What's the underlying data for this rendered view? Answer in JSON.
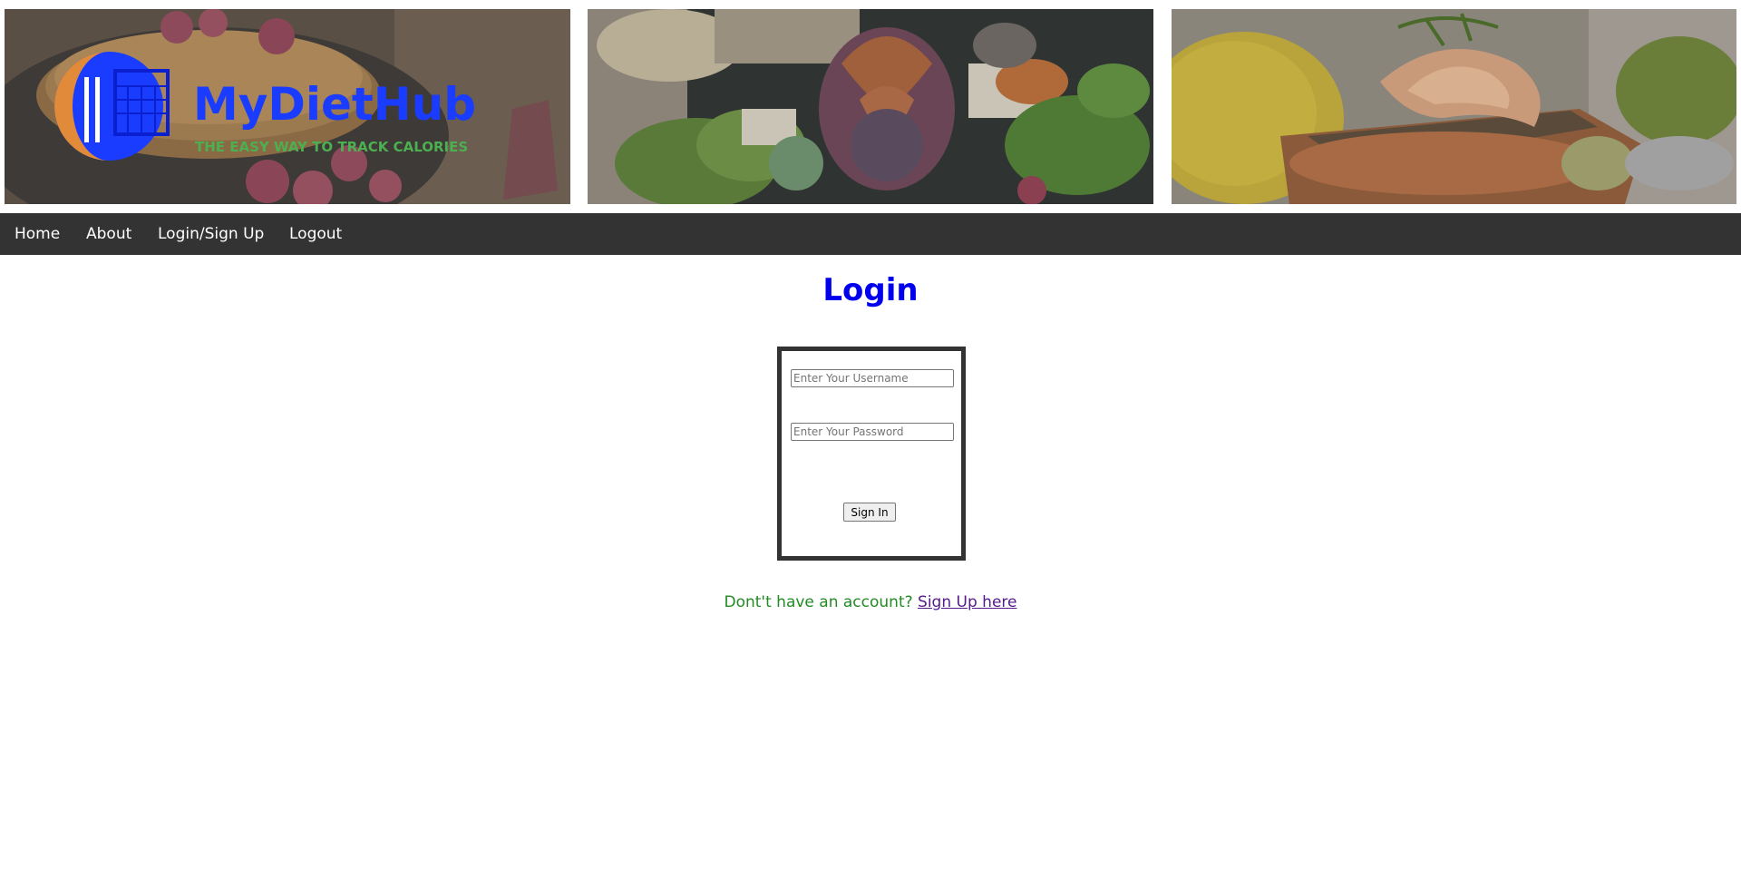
{
  "banner": {
    "logo": {
      "brand": "MyDietHub",
      "tagline": "THE EASY WAY TO TRACK CALORIES"
    },
    "images": [
      {
        "icon": "pancakes-raspberries-photo"
      },
      {
        "icon": "fig-salad-photo"
      },
      {
        "icon": "salmon-shrimp-photo"
      }
    ]
  },
  "nav": {
    "home": "Home",
    "about": "About",
    "login_signup": "Login/Sign Up",
    "logout": "Logout"
  },
  "page": {
    "title": "Login"
  },
  "form": {
    "username_placeholder": "Enter Your Username",
    "password_placeholder": "Enter Your Password",
    "submit_label": "Sign In"
  },
  "footer": {
    "prompt": "Dont't have an account? ",
    "link": "Sign Up here"
  },
  "colors": {
    "nav_bg": "#333333",
    "title": "#0000ee",
    "prompt": "#228b22",
    "link_visited": "#551a8b",
    "logo_blue": "#1a3cff",
    "logo_green": "#4caf50"
  }
}
